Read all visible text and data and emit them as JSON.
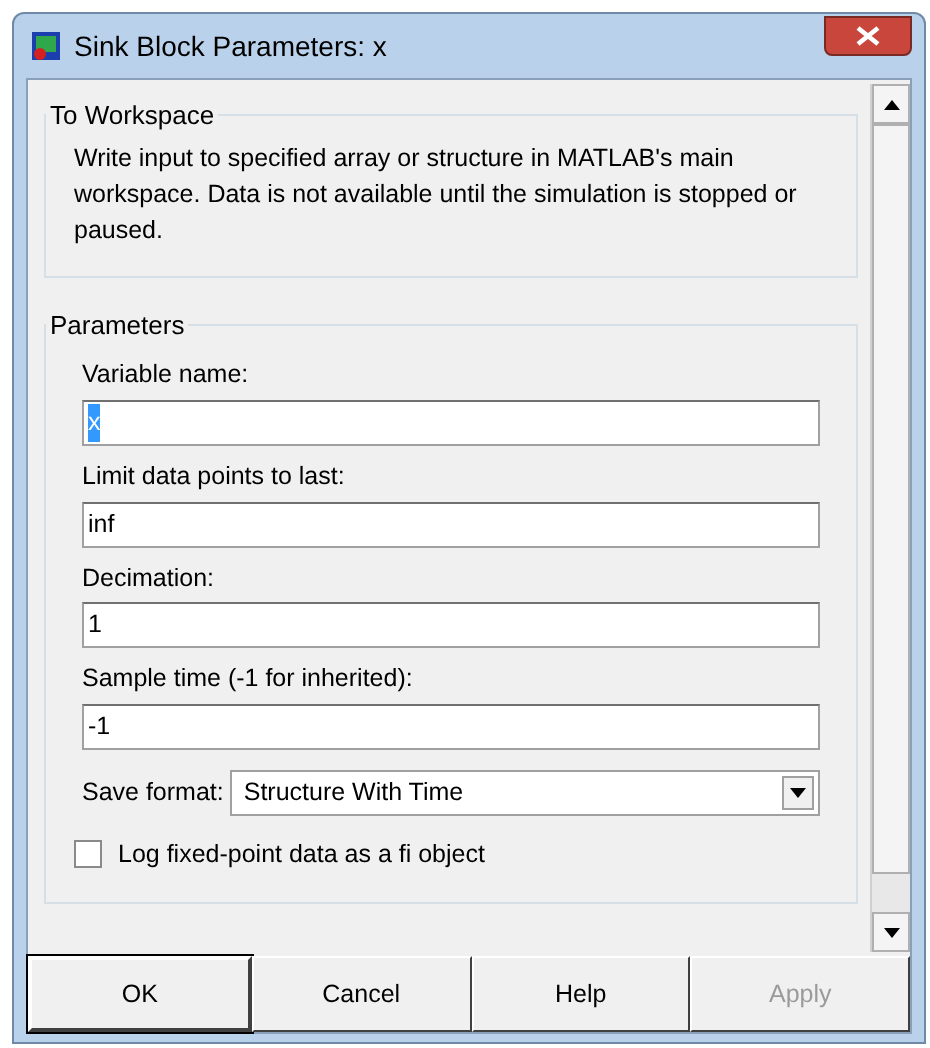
{
  "window": {
    "title": "Sink Block Parameters: x"
  },
  "description_group": {
    "title": "To Workspace",
    "text": "Write input to specified array or structure in MATLAB's main workspace. Data is not available until the simulation is stopped or paused."
  },
  "parameters_group": {
    "title": "Parameters",
    "fields": [
      {
        "label": "Variable name:",
        "value": "x",
        "text_selected": true
      },
      {
        "label": "Limit data points to last:",
        "value": "inf",
        "text_selected": false
      },
      {
        "label": "Decimation:",
        "value": "1",
        "text_selected": false
      },
      {
        "label": "Sample time (-1 for inherited):",
        "value": "-1",
        "text_selected": false
      }
    ],
    "save_format": {
      "label": "Save format:",
      "value": "Structure With Time"
    },
    "checkbox": {
      "label": "Log fixed-point data as a fi object",
      "checked": false
    }
  },
  "buttons": [
    {
      "label": "OK",
      "disabled": false,
      "default": true
    },
    {
      "label": "Cancel",
      "disabled": false,
      "default": false
    },
    {
      "label": "Help",
      "disabled": false,
      "default": false
    },
    {
      "label": "Apply",
      "disabled": true,
      "default": false
    }
  ]
}
